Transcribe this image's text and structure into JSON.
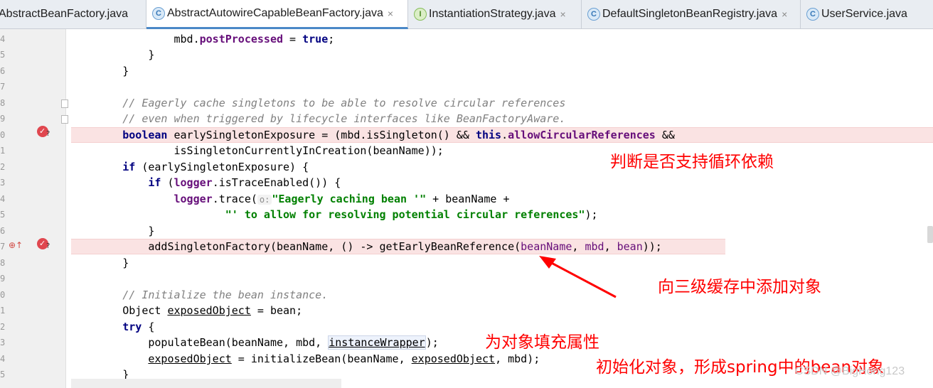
{
  "tabs": [
    {
      "label": "AbstractBeanFactory.java",
      "icon": "class-icon",
      "icon_glyph": "",
      "active": false,
      "closable": false
    },
    {
      "label": "AbstractAutowireCapableBeanFactory.java",
      "icon": "class-icon",
      "icon_glyph": "C",
      "active": true,
      "closable": true
    },
    {
      "label": "InstantiationStrategy.java",
      "icon": "interface-icon",
      "icon_glyph": "I",
      "active": false,
      "closable": true
    },
    {
      "label": "DefaultSingletonBeanRegistry.java",
      "icon": "class-icon",
      "icon_glyph": "C",
      "active": false,
      "closable": true
    },
    {
      "label": "UserService.java",
      "icon": "class-icon",
      "icon_glyph": "C",
      "active": false,
      "closable": false
    }
  ],
  "tab_close_glyph": "×",
  "line_numbers": [
    "4",
    "5",
    "6",
    "7",
    "8",
    "9",
    "0",
    "1",
    "2",
    "3",
    "4",
    "5",
    "6",
    "7",
    "8",
    "9",
    "0",
    "1",
    "2",
    "3",
    "4",
    "5",
    "6"
  ],
  "code": {
    "l1": {
      "pre": "                mbd.",
      "field": "postProcessed",
      "mid": " = ",
      "kw": "true",
      "end": ";"
    },
    "l2": "            }",
    "l3": "        }",
    "l5": "        // Eagerly cache singletons to be able to resolve circular references",
    "l6": "        // even when triggered by lifecycle interfaces like BeanFactoryAware.",
    "l7": {
      "kw1": "boolean",
      "a": " earlySingletonExposure = (mbd.isSingleton() && ",
      "kw2": "this",
      "dot": ".",
      "field": "allowCircularReferences",
      "end": " &&"
    },
    "l8": "                isSingletonCurrentlyInCreation(beanName));",
    "l9": {
      "kw": "if",
      "rest": " (earlySingletonExposure) {"
    },
    "l10": {
      "kw": "if",
      "open": " (",
      "field": "logger",
      "rest": ".isTraceEnabled()) {"
    },
    "l11": {
      "field": "logger",
      "a": ".trace(",
      "hint": "o:",
      "str": "\"Eagerly caching bean '\"",
      "end": " + beanName +"
    },
    "l12": {
      "str": "\"' to allow for resolving potential circular references\"",
      "end": ");"
    },
    "l13": "            }",
    "l14": {
      "a": "            addSingletonFactory(beanName, () -> getEarlyBeanReference(",
      "p1": "beanName",
      "c1": ", ",
      "p2": "mbd",
      "c2": ", ",
      "p3": "bean",
      "end": "));"
    },
    "l15": "        }",
    "l17": "        // Initialize the bean instance.",
    "l18": {
      "a": "        Object ",
      "u": "exposedObject",
      "end": " = bean;"
    },
    "l19": {
      "kw": "try",
      "end": " {"
    },
    "l20": {
      "a": "            populateBean(beanName, mbd, ",
      "boxed": "instanceWrapper",
      "end": ");"
    },
    "l21": {
      "u1": "exposedObject",
      "a": " = initializeBean(beanName, ",
      "u2": "exposedObject",
      "end": ", mbd);"
    },
    "l22": "        }"
  },
  "annotations": {
    "circular_check": "判断是否支持循环依赖",
    "third_cache": "向三级缓存中添加对象",
    "fill_props": "为对象填充属性",
    "init_bean": "初始化对象，形成spring中的bean对象"
  },
  "watermark": "CSDN @BigHong123",
  "colors": {
    "annotation": "#ff0000",
    "keyword": "#000080",
    "field": "#660e7a",
    "string": "#008000",
    "comment": "#808080",
    "breakpoint": "#e0474f"
  }
}
